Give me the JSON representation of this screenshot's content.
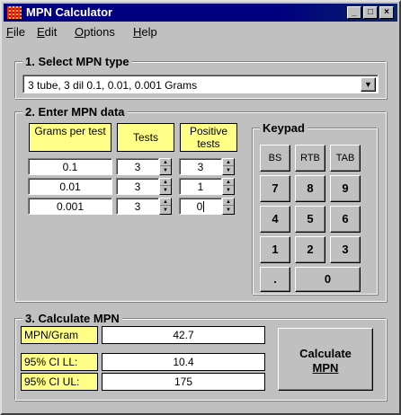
{
  "window": {
    "title": "MPN Calculator"
  },
  "menu": [
    {
      "label": "File",
      "underline": "F",
      "rest": "ile"
    },
    {
      "label": "Edit",
      "underline": "E",
      "rest": "dit"
    },
    {
      "label": "Options",
      "underline": "O",
      "rest": "ptions"
    },
    {
      "label": "Help",
      "underline": "H",
      "rest": "elp"
    }
  ],
  "section1": {
    "label": "1. Select MPN type",
    "selected": "3 tube, 3 dil 0.1, 0.01, 0.001 Grams"
  },
  "section2": {
    "label": "2. Enter MPN data",
    "headers": {
      "grams": "Grams per test",
      "tests": "Tests",
      "positive": "Positive tests"
    },
    "rows": [
      {
        "grams": "0.1",
        "tests": "3",
        "positive": "3"
      },
      {
        "grams": "0.01",
        "tests": "3",
        "positive": "1"
      },
      {
        "grams": "0.001",
        "tests": "3",
        "positive": "0"
      }
    ],
    "keypad": {
      "label": "Keypad",
      "keys": {
        "bs": "BS",
        "rtb": "RTB",
        "tab": "TAB",
        "k7": "7",
        "k8": "8",
        "k9": "9",
        "k4": "4",
        "k5": "5",
        "k6": "6",
        "k1": "1",
        "k2": "2",
        "k3": "3",
        "dot": ".",
        "k0": "0"
      }
    }
  },
  "section3": {
    "label": "3. Calculate MPN",
    "mpn_label": "MPN/Gram",
    "mpn_value": "42.7",
    "ll_label": "95% CI LL:",
    "ll_value": "10.4",
    "ul_label": "95% CI UL:",
    "ul_value": "175",
    "button_line1": "Calculate",
    "button_line2": "MPN"
  }
}
